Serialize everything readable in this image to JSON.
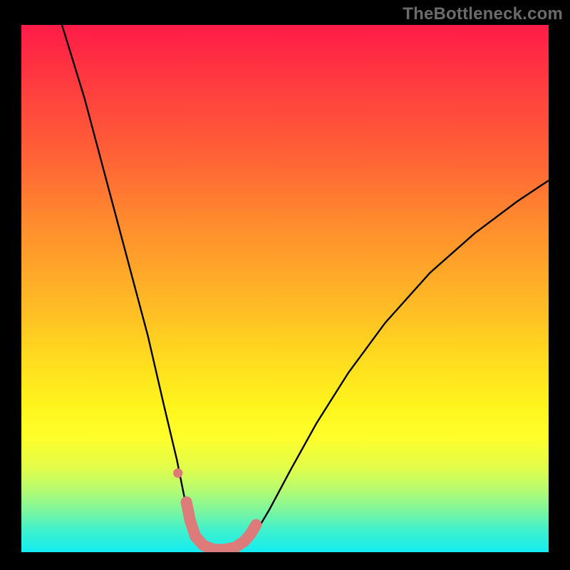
{
  "watermark": {
    "text": "TheBottleneck.com"
  },
  "colors": {
    "frame_bg_stops": [
      "#ff1b47",
      "#ff3e3f",
      "#ff6236",
      "#ff8a2e",
      "#ffb127",
      "#ffd720",
      "#fff41c",
      "#fffe2a",
      "#e2fd4a",
      "#b8fb6f",
      "#7ff69c",
      "#3ef0cf",
      "#14ecf0"
    ],
    "curve_stroke": "#000000",
    "marker_stroke": "#dd7b7b",
    "marker_dot_fill": "#dd7b7b"
  },
  "chart_data": {
    "type": "line",
    "title": "",
    "xlabel": "",
    "ylabel": "",
    "xlim": [
      0,
      100
    ],
    "ylim": [
      0,
      100
    ],
    "grid": false,
    "legend": false,
    "note": "No axes or tick labels are rendered; values are read off approximate pixel positions normalized to 0–100.",
    "series": [
      {
        "name": "bottleneck-curve",
        "stroke": "curve_stroke",
        "points_xy": [
          [
            7.7,
            100.0
          ],
          [
            12.0,
            86.0
          ],
          [
            16.0,
            71.0
          ],
          [
            20.0,
            56.0
          ],
          [
            24.0,
            41.0
          ],
          [
            27.0,
            28.0
          ],
          [
            29.5,
            17.5
          ],
          [
            31.0,
            10.0
          ],
          [
            32.5,
            4.0
          ],
          [
            34.5,
            1.0
          ],
          [
            37.0,
            0.3
          ],
          [
            40.0,
            0.3
          ],
          [
            42.0,
            1.0
          ],
          [
            44.0,
            3.0
          ],
          [
            47.0,
            8.0
          ],
          [
            51.0,
            15.5
          ],
          [
            56.0,
            24.5
          ],
          [
            62.0,
            34.0
          ],
          [
            69.0,
            43.5
          ],
          [
            77.5,
            53.0
          ],
          [
            86.0,
            60.5
          ],
          [
            94.0,
            66.5
          ],
          [
            100.0,
            70.5
          ]
        ]
      },
      {
        "name": "near-minimum-marker",
        "stroke": "marker_stroke",
        "points_xy": [
          [
            31.3,
            9.5
          ],
          [
            32.0,
            6.0
          ],
          [
            33.0,
            3.0
          ],
          [
            34.5,
            1.3
          ],
          [
            36.5,
            0.5
          ],
          [
            38.5,
            0.5
          ],
          [
            40.5,
            0.9
          ],
          [
            42.2,
            2.0
          ],
          [
            43.5,
            3.5
          ],
          [
            44.5,
            5.2
          ]
        ]
      }
    ],
    "annotations": [
      {
        "name": "marker-dot",
        "shape": "circle",
        "x": 29.7,
        "y": 15.0,
        "r_pct": 0.9,
        "fill": "marker_dot_fill"
      }
    ]
  }
}
